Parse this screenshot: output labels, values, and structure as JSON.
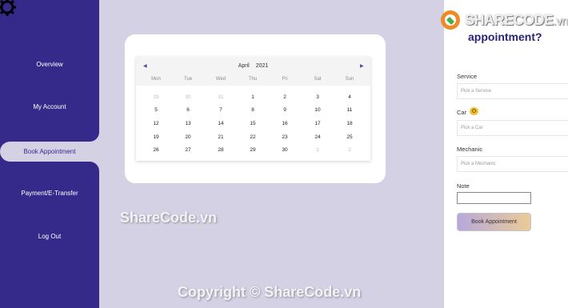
{
  "sidebar": {
    "items": [
      {
        "label": "Overview"
      },
      {
        "label": "My Account"
      },
      {
        "label": "Book Appointment"
      },
      {
        "label": "Payment/E-Transfer"
      },
      {
        "label": "Log Out"
      }
    ],
    "active_index": 2
  },
  "calendar": {
    "month": "April",
    "year": "2021",
    "weekdays": [
      "Mon",
      "Tue",
      "Wed",
      "Thu",
      "Fri",
      "Sat",
      "Sun"
    ],
    "weeks": [
      [
        "29",
        "30",
        "31",
        "1",
        "2",
        "3",
        "4"
      ],
      [
        "5",
        "6",
        "7",
        "8",
        "9",
        "10",
        "11"
      ],
      [
        "12",
        "13",
        "14",
        "15",
        "16",
        "17",
        "18"
      ],
      [
        "19",
        "20",
        "21",
        "22",
        "23",
        "24",
        "25"
      ],
      [
        "26",
        "27",
        "28",
        "29",
        "30",
        "1",
        "2"
      ]
    ],
    "muted": [
      [
        0,
        0
      ],
      [
        0,
        1
      ],
      [
        0,
        2
      ],
      [
        4,
        5
      ],
      [
        4,
        6
      ]
    ]
  },
  "form": {
    "heading_line2": "appointment?",
    "service_label": "Service",
    "service_placeholder": "Pick a Service",
    "car_label": "Car",
    "car_placeholder": "Pick a Car",
    "mechanic_label": "Mechanic",
    "mechanic_placeholder": "Pick a Mechanic",
    "note_label": "Note",
    "submit_label": "Book Appointment"
  },
  "watermark": {
    "logo_main": "SHARECODE",
    "logo_suffix": ".vn",
    "mid": "ShareCode.vn",
    "bottom": "Copyright © ShareCode.vn"
  },
  "colors": {
    "sidebar": "#352a8a",
    "background": "#d4d1e4",
    "heading": "#2a2478",
    "accent_logo": "#f08a24"
  }
}
